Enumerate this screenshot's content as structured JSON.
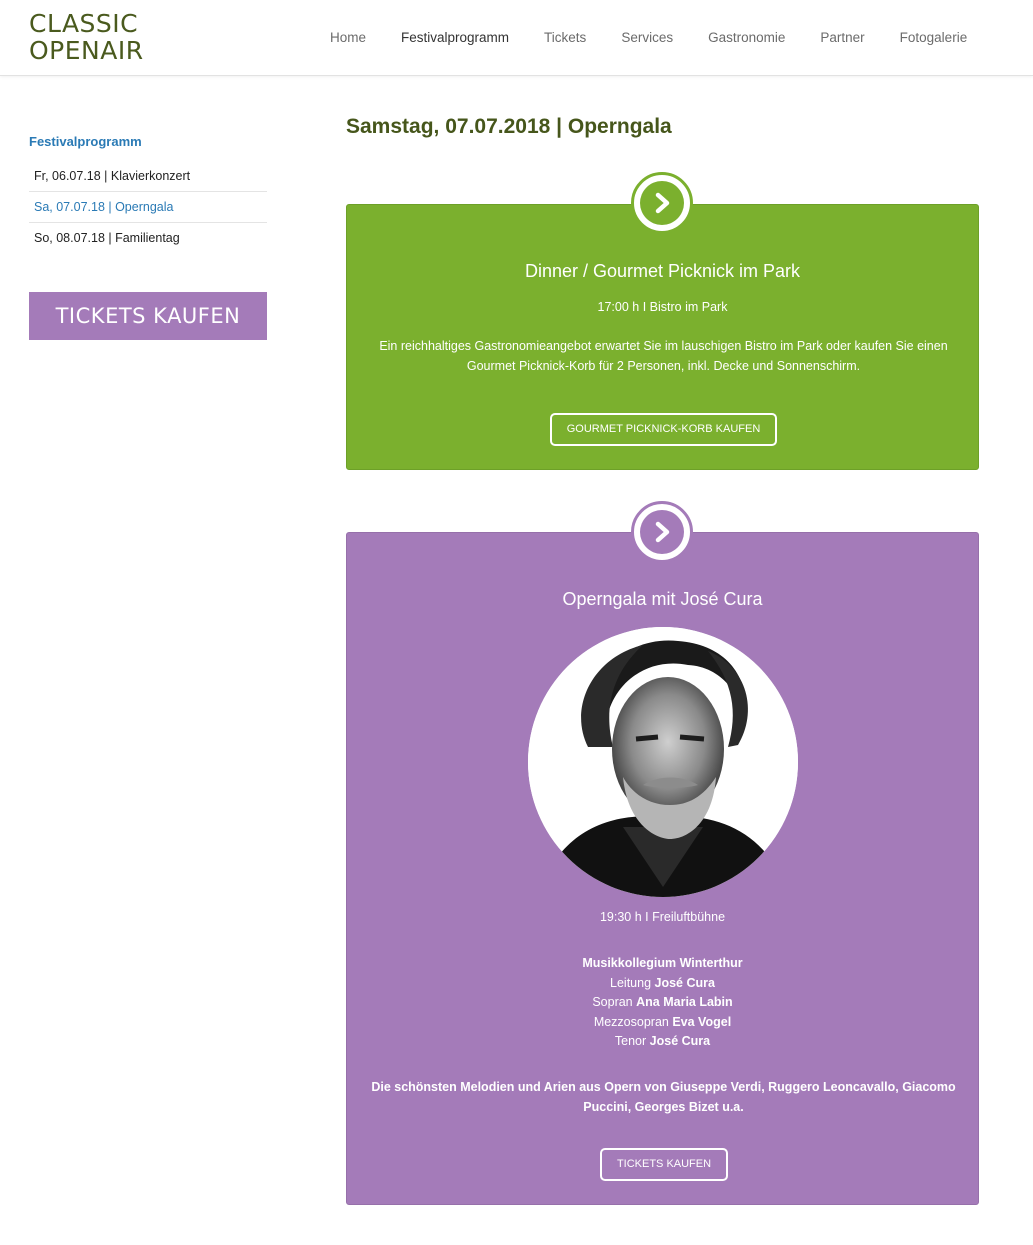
{
  "logo": {
    "line1": "CLASSIC",
    "line2": "OPENAIR"
  },
  "nav": {
    "items": [
      {
        "label": "Home"
      },
      {
        "label": "Festivalprogramm"
      },
      {
        "label": "Tickets"
      },
      {
        "label": "Services"
      },
      {
        "label": "Gastronomie"
      },
      {
        "label": "Partner"
      },
      {
        "label": "Fotogalerie"
      }
    ],
    "active": "Festivalprogramm"
  },
  "sidebar": {
    "title": "Festivalprogramm",
    "items": [
      {
        "label": "Fr, 06.07.18 | Klavierkonzert"
      },
      {
        "label": "Sa, 07.07.18 | Operngala"
      },
      {
        "label": "So, 08.07.18 | Familientag"
      }
    ],
    "tickets_button": "TICKETS KAUFEN"
  },
  "main": {
    "title": "Samstag, 07.07.2018 | Operngala",
    "dinner": {
      "title": "Dinner / Gourmet Picknick im Park",
      "time": "17:00 h I Bistro im Park",
      "description": "Ein reichhaltiges Gastronomieangebot erwartet Sie im lauschigen Bistro im Park oder kaufen Sie einen Gourmet Picknick-Korb für 2 Personen, inkl. Decke und Sonnenschirm.",
      "button": "GOURMET PICKNICK-KORB KAUFEN"
    },
    "gala": {
      "title": "Operngala mit José Cura",
      "time": "19:30 h I Freiluftbühne",
      "credits": {
        "orchestra": "Musikkollegium Winterthur",
        "leitung_role": "Leitung",
        "leitung_name": "José Cura",
        "sopran_role": "Sopran",
        "sopran_name": "Ana Maria Labin",
        "mezzo_role": "Mezzosopran",
        "mezzo_name": "Eva Vogel",
        "tenor_role": "Tenor",
        "tenor_name": "José Cura"
      },
      "description": "Die schönsten Melodien und Arien aus Opern von Giuseppe Verdi, Ruggero Leoncavallo, Giacomo Puccini, Georges Bizet u.a.",
      "button": "TICKETS KAUFEN"
    }
  },
  "colors": {
    "green": "#7bb02e",
    "purple": "#a47bb9",
    "link_blue": "#2a7ab5",
    "title_olive": "#46561b"
  }
}
